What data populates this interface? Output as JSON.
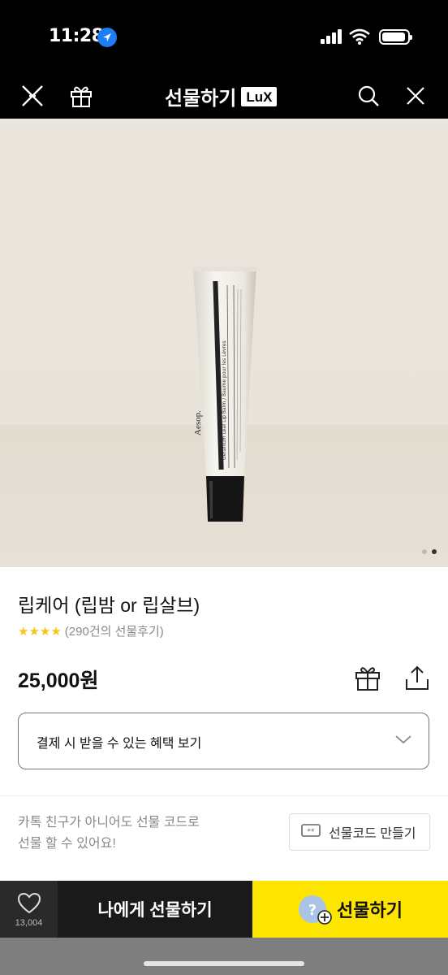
{
  "status_bar": {
    "time": "11:28"
  },
  "header": {
    "title": "선물하기",
    "badge": "LuX"
  },
  "product_image": {
    "brand": "Aesop.",
    "tube_text": "Geranium Leaf Lip Balm / Baume pour les Lèvres",
    "slide_index": 2,
    "slide_total": 2
  },
  "product": {
    "name": "립케어 (립밤 or 립살브)",
    "stars": "★★★★",
    "review_count": "(290건의 선물후기)",
    "price": "25,000원",
    "benefit_label": "결제 시 받을 수 있는 혜택 보기"
  },
  "gift_code": {
    "text_line1": "카톡 친구가 아니어도 선물 코드로",
    "text_line2": "선물 할 수 있어요!",
    "button_label": "선물코드 만들기"
  },
  "bottom_bar": {
    "wish_count": "13,004",
    "self_gift_label": "나에게 선물하기",
    "gift_label": "선물하기"
  },
  "colors": {
    "accent": "#fde500",
    "star": "#f5c518",
    "dark": "#1a1a1a"
  }
}
